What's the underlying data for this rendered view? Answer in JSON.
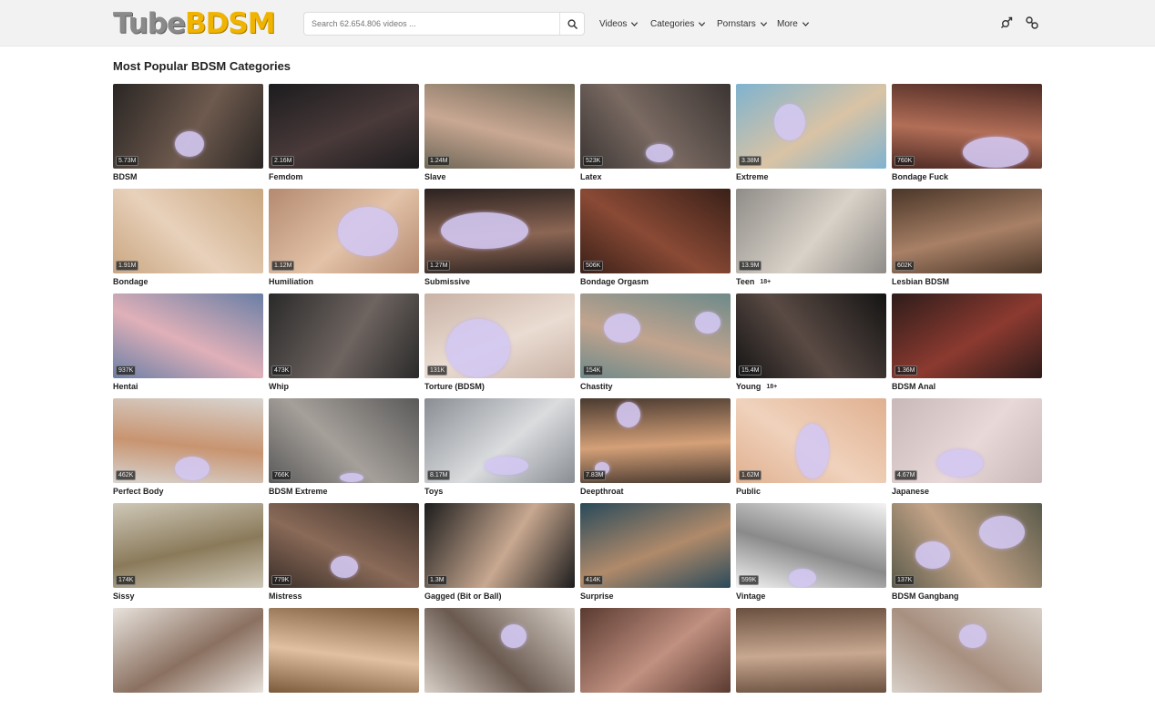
{
  "header": {
    "logo_part1": "Tube",
    "logo_part2": "BDSM",
    "search_placeholder": "Search 62.654.806 videos ...",
    "nav": [
      {
        "label": "Videos"
      },
      {
        "label": "Categories"
      },
      {
        "label": "Pornstars"
      },
      {
        "label": "More"
      }
    ]
  },
  "page_title": "Most Popular BDSM Categories",
  "categories": [
    {
      "name": "BDSM",
      "count": "5.73M",
      "colors": [
        "#2a2624",
        "#6e5a4e"
      ],
      "age": ""
    },
    {
      "name": "Femdom",
      "count": "2.16M",
      "colors": [
        "#1c1c1e",
        "#4a3a3a"
      ],
      "age": ""
    },
    {
      "name": "Slave",
      "count": "1.24M",
      "colors": [
        "#6e6656",
        "#c9a893"
      ],
      "age": ""
    },
    {
      "name": "Latex",
      "count": "523K",
      "colors": [
        "#3b3533",
        "#7a6a62"
      ],
      "age": ""
    },
    {
      "name": "Extreme",
      "count": "3.38M",
      "colors": [
        "#7fb3cf",
        "#d9c3a5"
      ],
      "age": ""
    },
    {
      "name": "Bondage Fuck",
      "count": "760K",
      "colors": [
        "#4d2a24",
        "#b26e57"
      ],
      "age": ""
    },
    {
      "name": "Bondage",
      "count": "1.91M",
      "colors": [
        "#c9a680",
        "#e8d1bb"
      ],
      "age": ""
    },
    {
      "name": "Humiliation",
      "count": "1.12M",
      "colors": [
        "#b48a70",
        "#e2c2a8"
      ],
      "age": ""
    },
    {
      "name": "Submissive",
      "count": "1.27M",
      "colors": [
        "#2b2220",
        "#8c6654"
      ],
      "age": ""
    },
    {
      "name": "Bondage Orgasm",
      "count": "506K",
      "colors": [
        "#3a2018",
        "#8a4a35"
      ],
      "age": ""
    },
    {
      "name": "Teen",
      "count": "13.9M",
      "colors": [
        "#8f8c88",
        "#d9d2c8"
      ],
      "age": "18+"
    },
    {
      "name": "Lesbian BDSM",
      "count": "602K",
      "colors": [
        "#4a3628",
        "#a88066"
      ],
      "age": ""
    },
    {
      "name": "Hentai",
      "count": "937K",
      "colors": [
        "#6a7fa6",
        "#e0b0b8"
      ],
      "age": ""
    },
    {
      "name": "Whip",
      "count": "473K",
      "colors": [
        "#2a2a2a",
        "#6e6460"
      ],
      "age": ""
    },
    {
      "name": "Torture (BDSM)",
      "count": "131K",
      "colors": [
        "#c9b2a6",
        "#eadcd2"
      ],
      "age": ""
    },
    {
      "name": "Chastity",
      "count": "154K",
      "colors": [
        "#6e8a8a",
        "#c2a48e"
      ],
      "age": ""
    },
    {
      "name": "Young",
      "count": "15.4M",
      "colors": [
        "#141414",
        "#5a4a44"
      ],
      "age": "18+"
    },
    {
      "name": "BDSM Anal",
      "count": "1.36M",
      "colors": [
        "#2e1c1a",
        "#8c3a30"
      ],
      "age": ""
    },
    {
      "name": "Perfect Body",
      "count": "462K",
      "colors": [
        "#d8d4d0",
        "#c89470"
      ],
      "age": ""
    },
    {
      "name": "BDSM Extreme",
      "count": "766K",
      "colors": [
        "#5a5a5a",
        "#a6a09a"
      ],
      "age": ""
    },
    {
      "name": "Toys",
      "count": "8.17M",
      "colors": [
        "#8a8e94",
        "#dadcde"
      ],
      "age": ""
    },
    {
      "name": "Deepthroat",
      "count": "7.83M",
      "colors": [
        "#4a3a30",
        "#d4a078"
      ],
      "age": ""
    },
    {
      "name": "Public",
      "count": "1.62M",
      "colors": [
        "#e0b090",
        "#f0d2bc"
      ],
      "age": ""
    },
    {
      "name": "Japanese",
      "count": "4.67M",
      "colors": [
        "#c8b8b8",
        "#e8d8d8"
      ],
      "age": ""
    },
    {
      "name": "Sissy",
      "count": "174K",
      "colors": [
        "#cfc8b8",
        "#8a7a5a"
      ],
      "age": ""
    },
    {
      "name": "Mistress",
      "count": "779K",
      "colors": [
        "#3a2e28",
        "#8a6a58"
      ],
      "age": ""
    },
    {
      "name": "Gagged (Bit or Ball)",
      "count": "1.3M",
      "colors": [
        "#1c1c1c",
        "#c8a890"
      ],
      "age": ""
    },
    {
      "name": "Surprise",
      "count": "414K",
      "colors": [
        "#2a4a5a",
        "#b08a6a"
      ],
      "age": ""
    },
    {
      "name": "Vintage",
      "count": "599K",
      "colors": [
        "#f4f4f4",
        "#8a8a8a"
      ],
      "age": ""
    },
    {
      "name": "BDSM Gangbang",
      "count": "137K",
      "colors": [
        "#5a5a4a",
        "#c4a488"
      ],
      "age": ""
    },
    {
      "name": "",
      "count": "",
      "colors": [
        "#e8e2dc",
        "#8a7060"
      ],
      "age": ""
    },
    {
      "name": "",
      "count": "",
      "colors": [
        "#7a5a3a",
        "#e0c0a0"
      ],
      "age": ""
    },
    {
      "name": "",
      "count": "",
      "colors": [
        "#d8d0c8",
        "#6a5a50"
      ],
      "age": ""
    },
    {
      "name": "",
      "count": "",
      "colors": [
        "#5a3a30",
        "#c09080"
      ],
      "age": ""
    },
    {
      "name": "",
      "count": "",
      "colors": [
        "#6a5040",
        "#c8a890"
      ],
      "age": ""
    },
    {
      "name": "",
      "count": "",
      "colors": [
        "#d8d0c8",
        "#a89080"
      ],
      "age": ""
    }
  ]
}
